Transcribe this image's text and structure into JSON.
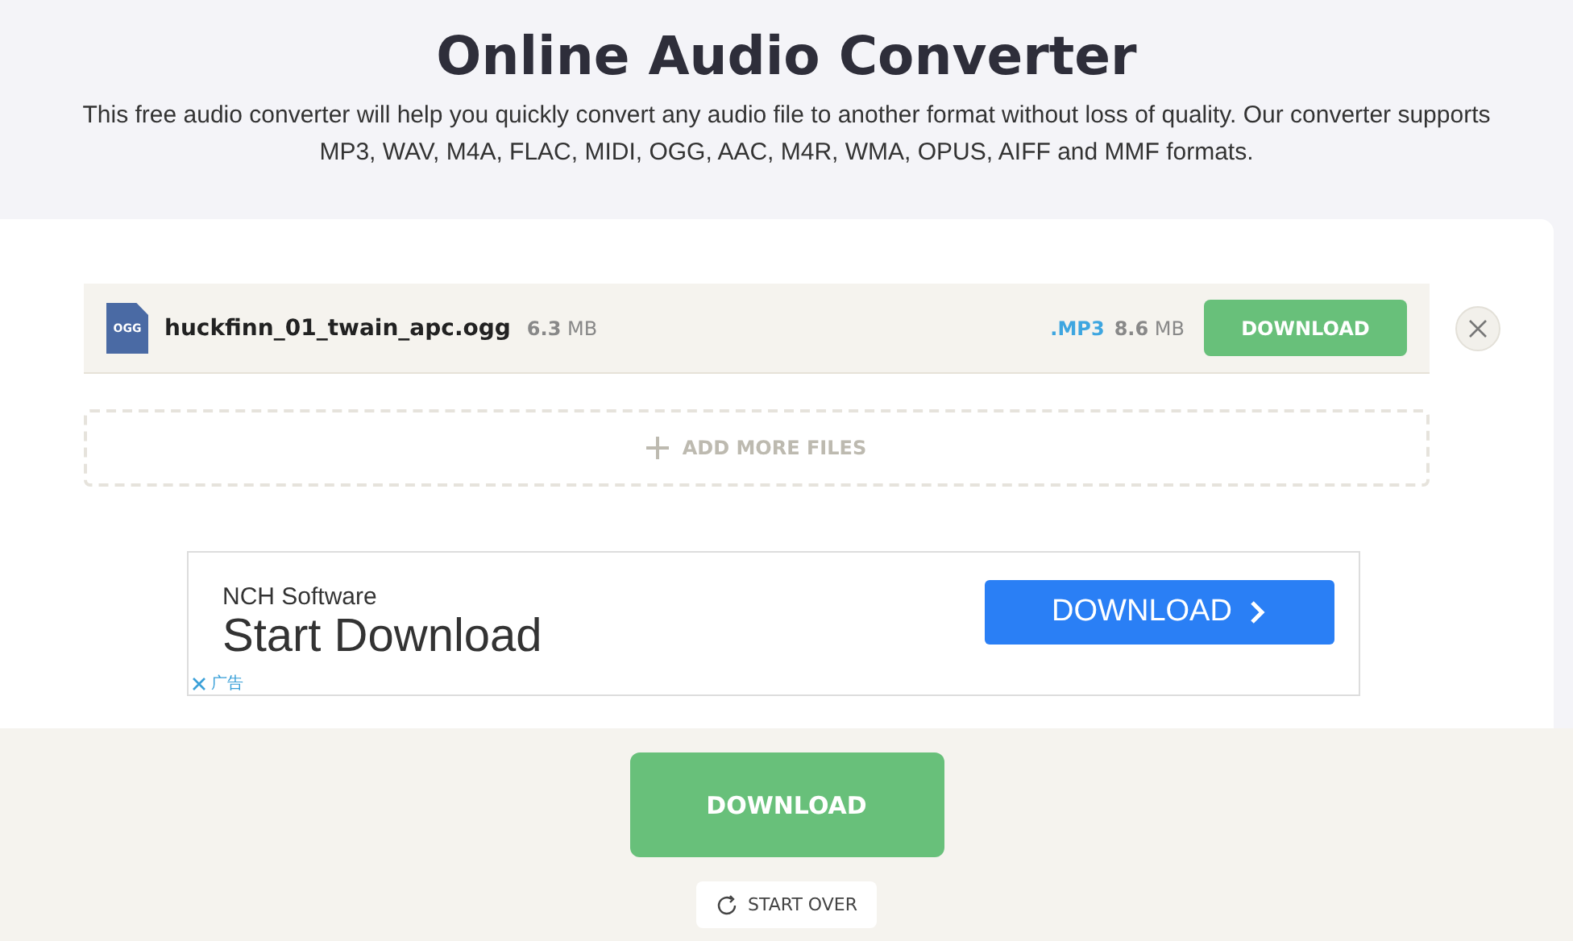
{
  "header": {
    "title": "Online Audio Converter",
    "description": "This free audio converter will help you quickly convert any audio file to another format without loss of quality. Our converter supports MP3, WAV, M4A, FLAC, MIDI, OGG, AAC, M4R, WMA, OPUS, AIFF and MMF formats."
  },
  "files": [
    {
      "badge": "OGG",
      "name": "huckfinn_01_twain_apc.ogg",
      "size": "**6.3** MB",
      "format": ".MP3",
      "output_size": "**8.6** MB",
      "button": "DOWNLOAD"
    }
  ],
  "add_more": {
    "label": "ADD MORE FILES"
  },
  "ad": {
    "brand": "NCH Software",
    "headline": "Start Download",
    "button": "DOWNLOAD",
    "label": "广告"
  },
  "footer": {
    "download": "DOWNLOAD",
    "start_over": "START OVER"
  }
}
